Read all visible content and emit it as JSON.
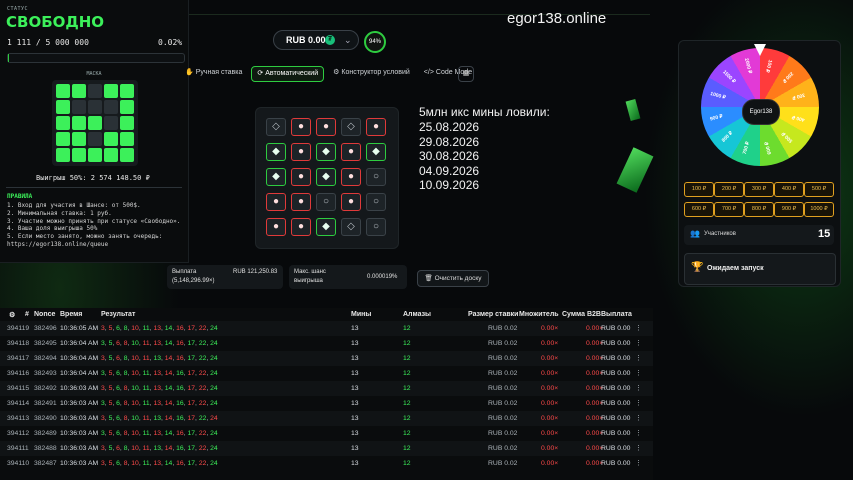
{
  "site_title": "egor138.online",
  "balance": {
    "label": "RUB 0.00",
    "coin_glyph": "₮",
    "chevron": "⌄"
  },
  "percent_badge": "94%",
  "status": {
    "label": "СТАТУС",
    "value": "СВОБОДНО",
    "count": "1 111 / 5 000 000",
    "percent": "0.02%",
    "progress_fraction": 0.0002,
    "mask_label": "МАСКА",
    "mask": [
      [
        1,
        1,
        0,
        1,
        1
      ],
      [
        1,
        0,
        0,
        0,
        1
      ],
      [
        1,
        1,
        1,
        0,
        1
      ],
      [
        1,
        1,
        0,
        1,
        1
      ],
      [
        1,
        1,
        1,
        1,
        1
      ]
    ],
    "win_line": "Выигрыш 50%: 2 574 148.50 ₽",
    "rules_title": "ПРАВИЛА",
    "rules": [
      "1. Вход для участия в Шансе: от 500$.",
      "2. Минимальная ставка: 1 руб.",
      "3. Участие можно принять при статусе «Свободно».",
      "4. Ваша доля выигрыша 50%",
      "5. Если место занято, можно занять очередь:",
      "https://egor138.online/queue"
    ]
  },
  "tabs": [
    {
      "label": "Ручная ставка",
      "icon": "hand-icon",
      "active": false
    },
    {
      "label": "Автоматический",
      "icon": "refresh-icon",
      "active": true
    },
    {
      "label": "Конструктор условий",
      "icon": "gear-icon",
      "active": false
    },
    {
      "label": "Code Mode",
      "icon": "code-icon",
      "active": false
    }
  ],
  "board": [
    [
      "empty",
      "bomb",
      "bomb",
      "empty",
      "bomb"
    ],
    [
      "gem",
      "bomb",
      "gem",
      "bomb",
      "gem"
    ],
    [
      "gem",
      "bomb",
      "gem",
      "bomb",
      "empty"
    ],
    [
      "bomb",
      "bomb",
      "empty",
      "bomb",
      "empty"
    ],
    [
      "bomb",
      "bomb",
      "gem",
      "empty",
      "empty"
    ]
  ],
  "overlay": {
    "heading": "5млн икс мины ловили:",
    "dates": [
      "25.08.2026",
      "29.08.2026",
      "30.08.2026",
      "04.09.2026",
      "10.09.2026"
    ]
  },
  "stats": {
    "payout_label": "Выплата",
    "payout_value": "RUB 121,250.83",
    "payout_sub": "(5,148,296.99×)",
    "max_chance_label": "Макс. шанс",
    "max_chance_label2": "выигрыша",
    "max_chance_value": "0.000019%",
    "clear_button": "Очистить доску"
  },
  "wheel": {
    "center": "Egor138",
    "segments": [
      {
        "label": "100 ₽",
        "color": "#ff3b3b"
      },
      {
        "label": "200 ₽",
        "color": "#ff7a1a"
      },
      {
        "label": "300 ₽",
        "color": "#ffb21a"
      },
      {
        "label": "400 ₽",
        "color": "#ffe01a"
      },
      {
        "label": "500 ₽",
        "color": "#c6e81e"
      },
      {
        "label": "600 ₽",
        "color": "#6ddc2e"
      },
      {
        "label": "700 ₽",
        "color": "#1fd18a"
      },
      {
        "label": "800 ₽",
        "color": "#16c6d6"
      },
      {
        "label": "900 ₽",
        "color": "#2b8dff"
      },
      {
        "label": "1000 ₽",
        "color": "#5a5cff"
      },
      {
        "label": "1500 ₽",
        "color": "#9b45ff"
      },
      {
        "label": "2000 ₽",
        "color": "#e23ad6"
      }
    ],
    "prizes_row1": [
      "100 ₽",
      "200 ₽",
      "300 ₽",
      "400 ₽",
      "500 ₽"
    ],
    "prizes_row2": [
      "600 ₽",
      "700 ₽",
      "800 ₽",
      "900 ₽",
      "1000 ₽"
    ],
    "participants_label": "Участников",
    "participants_value": "15",
    "waiting_label": "Ожидаем запуск"
  },
  "table": {
    "headers": {
      "settings": "⚙",
      "id": "#",
      "nonce": "Nonce",
      "time": "Время",
      "result": "Результат",
      "mines": "Мины",
      "gems": "Алмазы",
      "bet": "Размер ставки",
      "mult": "Множитель",
      "b2b": "Сумма B2B",
      "payout": "Выплата"
    },
    "rows": [
      {
        "id": "394119",
        "nonce": "382496",
        "time": "10:36:05 AM",
        "result": [
          [
            "3",
            "r"
          ],
          [
            "5",
            "r"
          ],
          [
            "6",
            "g"
          ],
          [
            "8",
            "g"
          ],
          [
            "10",
            "r"
          ],
          [
            "11",
            "g"
          ],
          [
            "13",
            "r"
          ],
          [
            "14",
            "g"
          ],
          [
            "16",
            "r"
          ],
          [
            "17",
            "r"
          ],
          [
            "22",
            "r"
          ],
          [
            "24",
            "g"
          ]
        ],
        "mines": "13",
        "gems": "12",
        "bet": "RUB 0.02",
        "mult": "0.00×",
        "b2b": "0.00×",
        "payout": "RUB 0.00"
      },
      {
        "id": "394118",
        "nonce": "382495",
        "time": "10:36:04 AM",
        "result": [
          [
            "3",
            "g"
          ],
          [
            "5",
            "g"
          ],
          [
            "6",
            "r"
          ],
          [
            "8",
            "r"
          ],
          [
            "10",
            "g"
          ],
          [
            "11",
            "r"
          ],
          [
            "13",
            "r"
          ],
          [
            "14",
            "g"
          ],
          [
            "16",
            "r"
          ],
          [
            "17",
            "g"
          ],
          [
            "22",
            "g"
          ],
          [
            "24",
            "g"
          ]
        ],
        "mines": "13",
        "gems": "12",
        "bet": "RUB 0.02",
        "mult": "0.00×",
        "b2b": "0.00×",
        "payout": "RUB 0.00"
      },
      {
        "id": "394117",
        "nonce": "382494",
        "time": "10:36:04 AM",
        "result": [
          [
            "3",
            "r"
          ],
          [
            "5",
            "g"
          ],
          [
            "6",
            "r"
          ],
          [
            "8",
            "g"
          ],
          [
            "10",
            "r"
          ],
          [
            "11",
            "r"
          ],
          [
            "13",
            "g"
          ],
          [
            "14",
            "r"
          ],
          [
            "16",
            "r"
          ],
          [
            "17",
            "g"
          ],
          [
            "22",
            "g"
          ],
          [
            "24",
            "g"
          ]
        ],
        "mines": "13",
        "gems": "12",
        "bet": "RUB 0.02",
        "mult": "0.00×",
        "b2b": "0.00×",
        "payout": "RUB 0.00"
      },
      {
        "id": "394116",
        "nonce": "382493",
        "time": "10:36:04 AM",
        "result": [
          [
            "3",
            "g"
          ],
          [
            "5",
            "r"
          ],
          [
            "6",
            "g"
          ],
          [
            "8",
            "g"
          ],
          [
            "10",
            "r"
          ],
          [
            "11",
            "g"
          ],
          [
            "13",
            "r"
          ],
          [
            "14",
            "r"
          ],
          [
            "16",
            "g"
          ],
          [
            "17",
            "r"
          ],
          [
            "22",
            "r"
          ],
          [
            "24",
            "g"
          ]
        ],
        "mines": "13",
        "gems": "12",
        "bet": "RUB 0.02",
        "mult": "0.00×",
        "b2b": "0.00×",
        "payout": "RUB 0.00"
      },
      {
        "id": "394115",
        "nonce": "382492",
        "time": "10:36:03 AM",
        "result": [
          [
            "3",
            "r"
          ],
          [
            "5",
            "r"
          ],
          [
            "6",
            "g"
          ],
          [
            "8",
            "r"
          ],
          [
            "10",
            "g"
          ],
          [
            "11",
            "g"
          ],
          [
            "13",
            "r"
          ],
          [
            "14",
            "g"
          ],
          [
            "16",
            "g"
          ],
          [
            "17",
            "r"
          ],
          [
            "22",
            "r"
          ],
          [
            "24",
            "g"
          ]
        ],
        "mines": "13",
        "gems": "12",
        "bet": "RUB 0.02",
        "mult": "0.00×",
        "b2b": "0.00×",
        "payout": "RUB 0.00"
      },
      {
        "id": "394114",
        "nonce": "382491",
        "time": "10:36:03 AM",
        "result": [
          [
            "3",
            "g"
          ],
          [
            "5",
            "r"
          ],
          [
            "6",
            "g"
          ],
          [
            "8",
            "r"
          ],
          [
            "10",
            "r"
          ],
          [
            "11",
            "g"
          ],
          [
            "13",
            "r"
          ],
          [
            "14",
            "r"
          ],
          [
            "16",
            "g"
          ],
          [
            "17",
            "r"
          ],
          [
            "22",
            "r"
          ],
          [
            "24",
            "g"
          ]
        ],
        "mines": "13",
        "gems": "12",
        "bet": "RUB 0.02",
        "mult": "0.00×",
        "b2b": "0.00×",
        "payout": "RUB 0.00"
      },
      {
        "id": "394113",
        "nonce": "382490",
        "time": "10:36:03 AM",
        "result": [
          [
            "3",
            "r"
          ],
          [
            "5",
            "g"
          ],
          [
            "6",
            "g"
          ],
          [
            "8",
            "r"
          ],
          [
            "10",
            "g"
          ],
          [
            "11",
            "r"
          ],
          [
            "13",
            "g"
          ],
          [
            "14",
            "r"
          ],
          [
            "16",
            "g"
          ],
          [
            "17",
            "r"
          ],
          [
            "22",
            "g"
          ],
          [
            "24",
            "r"
          ]
        ],
        "mines": "13",
        "gems": "12",
        "bet": "RUB 0.02",
        "mult": "0.00×",
        "b2b": "0.00×",
        "payout": "RUB 0.00"
      },
      {
        "id": "394112",
        "nonce": "382489",
        "time": "10:36:03 AM",
        "result": [
          [
            "3",
            "g"
          ],
          [
            "5",
            "r"
          ],
          [
            "6",
            "g"
          ],
          [
            "8",
            "r"
          ],
          [
            "10",
            "r"
          ],
          [
            "11",
            "g"
          ],
          [
            "13",
            "r"
          ],
          [
            "14",
            "g"
          ],
          [
            "16",
            "r"
          ],
          [
            "17",
            "g"
          ],
          [
            "22",
            "r"
          ],
          [
            "24",
            "g"
          ]
        ],
        "mines": "13",
        "gems": "12",
        "bet": "RUB 0.02",
        "mult": "0.00×",
        "b2b": "0.00×",
        "payout": "RUB 0.00"
      },
      {
        "id": "394111",
        "nonce": "382488",
        "time": "10:36:03 AM",
        "result": [
          [
            "3",
            "r"
          ],
          [
            "5",
            "g"
          ],
          [
            "6",
            "r"
          ],
          [
            "8",
            "g"
          ],
          [
            "10",
            "r"
          ],
          [
            "11",
            "r"
          ],
          [
            "13",
            "g"
          ],
          [
            "14",
            "r"
          ],
          [
            "16",
            "g"
          ],
          [
            "17",
            "g"
          ],
          [
            "22",
            "r"
          ],
          [
            "24",
            "g"
          ]
        ],
        "mines": "13",
        "gems": "12",
        "bet": "RUB 0.02",
        "mult": "0.00×",
        "b2b": "0.00×",
        "payout": "RUB 0.00"
      },
      {
        "id": "394110",
        "nonce": "382487",
        "time": "10:36:03 AM",
        "result": [
          [
            "3",
            "r"
          ],
          [
            "5",
            "r"
          ],
          [
            "6",
            "g"
          ],
          [
            "8",
            "r"
          ],
          [
            "10",
            "r"
          ],
          [
            "11",
            "g"
          ],
          [
            "13",
            "r"
          ],
          [
            "14",
            "g"
          ],
          [
            "16",
            "r"
          ],
          [
            "17",
            "g"
          ],
          [
            "22",
            "r"
          ],
          [
            "24",
            "g"
          ]
        ],
        "mines": "13",
        "gems": "12",
        "bet": "RUB 0.02",
        "mult": "0.00×",
        "b2b": "0.00×",
        "payout": "RUB 0.00"
      }
    ]
  }
}
